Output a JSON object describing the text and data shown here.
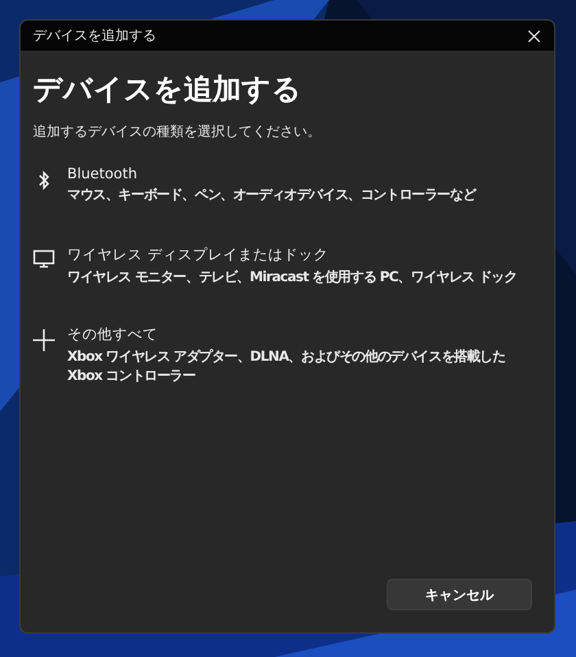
{
  "window": {
    "title": "デバイスを追加する"
  },
  "heading": "デバイスを追加する",
  "subtitle": "追加するデバイスの種類を選択してください。",
  "options": [
    {
      "kind": "bluetooth",
      "title": "Bluetooth",
      "description": "マウス、キーボード、ペン、オーディオデバイス、コントローラーなど"
    },
    {
      "kind": "display",
      "title": "ワイヤレス ディスプレイまたはドック",
      "description": "ワイヤレス モニター、テレビ、Miracast を使用する PC、ワイヤレス ドック"
    },
    {
      "kind": "other",
      "title": "その他すべて",
      "description": "Xbox ワイヤレス アダプター、DLNA、およびその他のデバイスを搭載した Xbox コントローラー"
    }
  ],
  "buttons": [
    "キャンセル"
  ]
}
